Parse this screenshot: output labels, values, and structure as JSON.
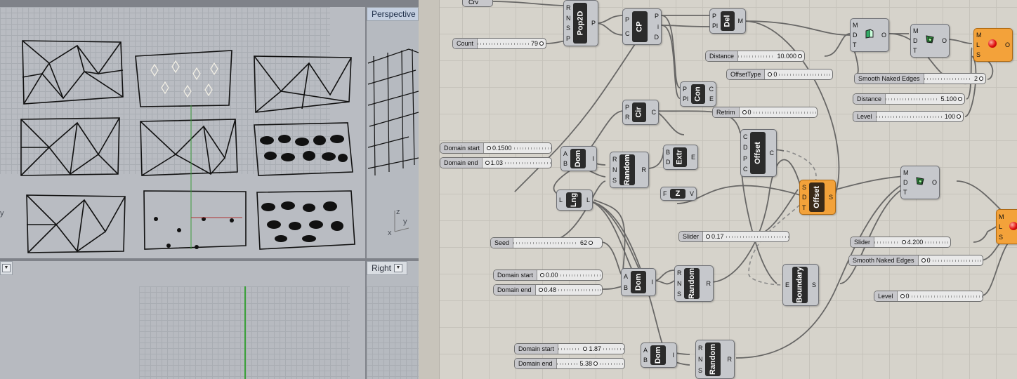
{
  "viewports": {
    "perspective": {
      "label": "Perspective"
    },
    "right": {
      "label": "Right"
    }
  },
  "axes": {
    "x": "x",
    "y": "y",
    "z": "z"
  },
  "gh": {
    "param_crv": "Crv",
    "count": {
      "label": "Count",
      "value": "79"
    },
    "pop2d": {
      "name": "Pop2D",
      "inputs": [
        "R",
        "N",
        "S",
        "P"
      ],
      "outputs": [
        "P"
      ]
    },
    "cp": {
      "name": "CP",
      "inputs": [
        "P",
        "C"
      ],
      "outputs": [
        "P",
        "i",
        "D"
      ]
    },
    "del": {
      "name": "Del",
      "inputs": [
        "P",
        "Pl"
      ],
      "outputs": [
        "M"
      ]
    },
    "con": {
      "name": "Con",
      "inputs": [
        "P",
        "Pl"
      ],
      "outputs": [
        "C",
        "E"
      ]
    },
    "cir": {
      "name": "Cir",
      "inputs": [
        "P",
        "R"
      ],
      "outputs": [
        "C"
      ]
    },
    "extr": {
      "name": "Extr",
      "inputs": [
        "B",
        "D"
      ],
      "outputs": [
        "E"
      ]
    },
    "z": {
      "name": "Z",
      "inputs": [
        "F"
      ],
      "outputs": [
        "V"
      ]
    },
    "offset1": {
      "name": "Offset",
      "inputs": [
        "C",
        "D",
        "P",
        "C"
      ],
      "outputs": [
        "C"
      ]
    },
    "offset2": {
      "name": "Offset",
      "inputs": [
        "S",
        "D",
        "T"
      ],
      "outputs": [
        "S"
      ]
    },
    "dom1": {
      "name": "Dom",
      "inputs": [
        "A",
        "B"
      ],
      "outputs": [
        "I"
      ]
    },
    "random1": {
      "name": "Random",
      "inputs": [
        "R",
        "N",
        "S"
      ],
      "outputs": [
        "R"
      ]
    },
    "lng": {
      "name": "Lng",
      "inputs": [
        "L"
      ],
      "outputs": [
        "L"
      ]
    },
    "dom2": {
      "name": "Dom",
      "inputs": [
        "A",
        "B"
      ],
      "outputs": [
        "I"
      ]
    },
    "random2": {
      "name": "Random",
      "inputs": [
        "R",
        "N",
        "S"
      ],
      "outputs": [
        "R"
      ]
    },
    "boundary": {
      "name": "Boundary",
      "inputs": [
        "E"
      ],
      "outputs": [
        "S"
      ]
    },
    "dom3": {
      "name": "Dom",
      "inputs": [
        "A",
        "B"
      ],
      "outputs": [
        "I"
      ]
    },
    "random3": {
      "name": "Random",
      "inputs": [
        "R",
        "N",
        "S"
      ],
      "outputs": [
        "R"
      ]
    },
    "mesh1": {
      "inputs": [
        "M",
        "D",
        "T"
      ],
      "outputs": [
        "O"
      ]
    },
    "mesh2": {
      "inputs": [
        "M",
        "D",
        "T"
      ],
      "outputs": [
        "O"
      ]
    },
    "mesh3": {
      "inputs": [
        "M",
        "D",
        "T"
      ],
      "outputs": [
        "O"
      ]
    },
    "wb1": {
      "inputs": [
        "M",
        "L",
        "S"
      ],
      "outputs": [
        "O"
      ]
    },
    "wb2": {
      "inputs": [
        "M",
        "L",
        "S"
      ],
      "outputs": [
        "O"
      ]
    },
    "distance1": {
      "label": "Distance",
      "value": "10.000"
    },
    "offsettype": {
      "label": "OffsetType",
      "value": "0"
    },
    "smooth1": {
      "label": "Smooth Naked Edges",
      "value": "2"
    },
    "distance2": {
      "label": "Distance",
      "value": "5.100"
    },
    "level1": {
      "label": "Level",
      "value": "100"
    },
    "retrim": {
      "label": "Retrim",
      "value": "0"
    },
    "domstart1": {
      "label": "Domain start",
      "value": "0.1500"
    },
    "domend1": {
      "label": "Domain end",
      "value": "1.03"
    },
    "slider017": {
      "label": "Slider",
      "value": "0.17"
    },
    "seed": {
      "label": "Seed",
      "value": "62"
    },
    "domstart2": {
      "label": "Domain start",
      "value": "0.00"
    },
    "domend2": {
      "label": "Domain end",
      "value": "0.48"
    },
    "slider42": {
      "label": "Slider",
      "value": "4.200"
    },
    "smooth2": {
      "label": "Smooth Naked Edges",
      "value": "0"
    },
    "level2": {
      "label": "Level",
      "value": "0"
    },
    "domstart3": {
      "label": "Domain start",
      "value": "1.87"
    },
    "domend3": {
      "label": "Domain end",
      "value": "5.38"
    }
  }
}
